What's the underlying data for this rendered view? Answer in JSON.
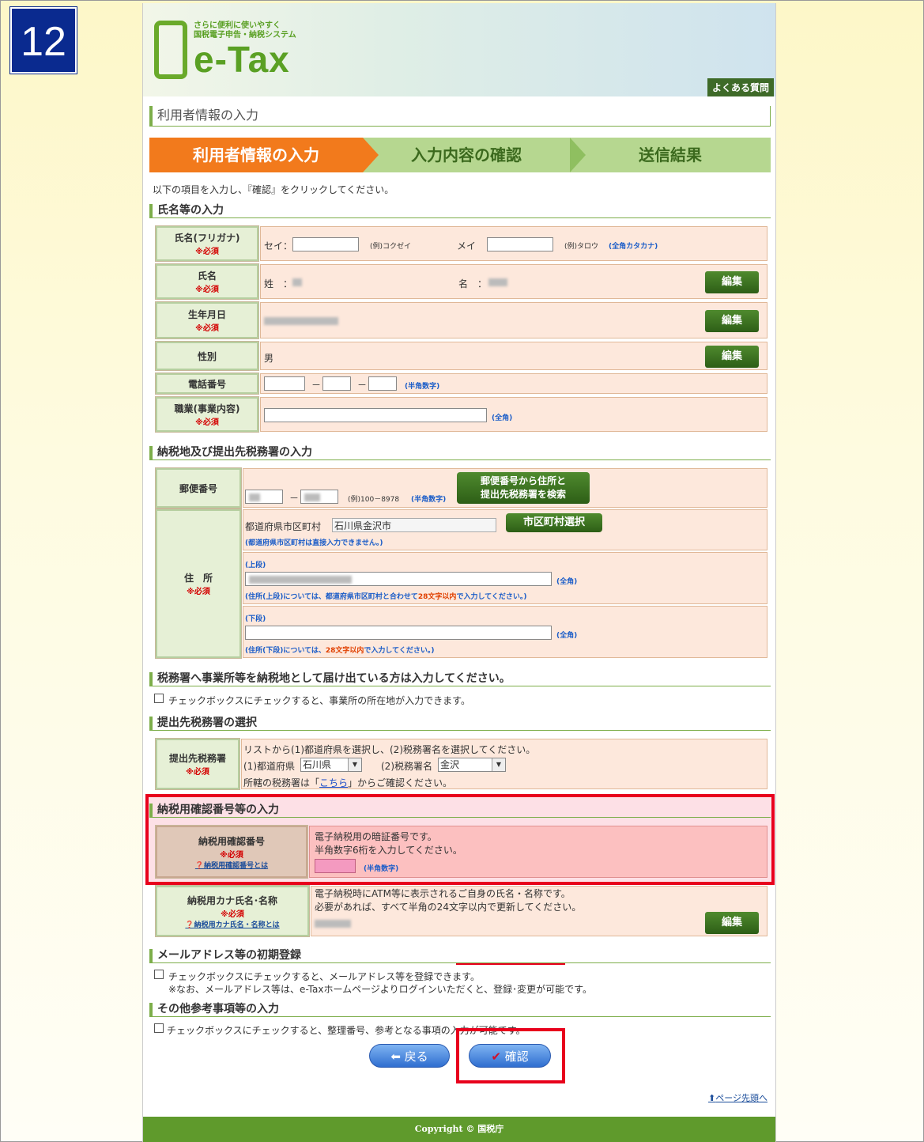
{
  "step_number": "12",
  "header": {
    "tagline1": "さらに便利に使いやすく",
    "tagline2": "国税電子申告・納税システム",
    "logo": "e-Tax",
    "faq": "よくある質問"
  },
  "page_title": "利用者情報の入力",
  "steps": [
    "利用者情報の入力",
    "入力内容の確認",
    "送信結果"
  ],
  "instruction": "以下の項目を入力し、『確認』をクリックしてください。",
  "required": "※必須",
  "section1": {
    "title": "氏名等の入力",
    "furigana": {
      "label": "氏名(フリガナ)",
      "sei": "セイ：",
      "sei_ex": "(例)コクゼイ",
      "mei": "メイ　：",
      "mei_ex": "(例)タロウ",
      "note": "(全角カタカナ)"
    },
    "name": {
      "label": "氏名",
      "sei": "姓　：",
      "mei": "名　：",
      "edit": "編集"
    },
    "birth": {
      "label": "生年月日",
      "edit": "編集"
    },
    "gender": {
      "label": "性別",
      "value": "男",
      "edit": "編集"
    },
    "phone": {
      "label": "電話番号",
      "dash": "－",
      "note": "(半角数字)"
    },
    "job": {
      "label": "職業(事業内容)",
      "note": "(全角)"
    }
  },
  "section2": {
    "title": "納税地及び提出先税務署の入力",
    "postal": {
      "label": "郵便番号",
      "dash": "－",
      "ex": "(例)100－8978",
      "note": "(半角数字)",
      "search1": "郵便番号から住所と",
      "search2": "提出先税務署を検索"
    },
    "address": {
      "label": "住　所",
      "city_label": "都道府県市区町村",
      "city_value": "石川県金沢市",
      "city_btn": "市区町村選択",
      "city_note": "(都道府県市区町村は直接入力できません。)",
      "upper": "(上段)",
      "upper_note_a": "(住所(上段)については、都道府県市区町村と合わせて",
      "upper_note_red": "28文字以内",
      "upper_note_b": "で入力してください。)",
      "lower": "(下段)",
      "lower_note_a": "(住所(下段)については、",
      "lower_note_red": "28文字以内",
      "lower_note_b": "で入力してください。)",
      "fw": "(全角)"
    }
  },
  "section3": {
    "title": "税務署へ事業所等を納税地として届け出ている方は入力してください。",
    "check": "チェックボックスにチェックすると、事業所の所在地が入力できます。"
  },
  "section4": {
    "title": "提出先税務署の選択",
    "label": "提出先税務署",
    "line1": "リストから(1)都道府県を選択し、(2)税務署名を選択してください。",
    "pref_label": "(1)都道府県",
    "pref_value": "石川県",
    "office_label": "(2)税務署名",
    "office_value": "金沢",
    "line3a": "所轄の税務署は「",
    "link": "こちら",
    "line3b": "」からご確認ください。"
  },
  "section5": {
    "title": "納税用確認番号等の入力",
    "pin": {
      "label": "納税用確認番号",
      "help": "納税用確認番号とは",
      "line1": "電子納税用の暗証番号です。",
      "line2": "半角数字6桁を入力してください。",
      "note": "(半角数字)"
    },
    "kana": {
      "label": "納税用カナ氏名･名称",
      "help": "納税用カナ氏名・名称とは",
      "line1": "電子納税時にATM等に表示されるご自身の氏名・名称です。",
      "line2": "必要があれば、すべて半角の24文字以内で更新してください。",
      "edit": "編集"
    }
  },
  "section6": {
    "title": "メールアドレス等の初期登録",
    "check": "チェックボックスにチェックすると、メールアドレス等を登録できます。",
    "note": "※なお、メールアドレス等は、e-Taxホームページよりログインいただくと、登録･変更が可能です。"
  },
  "section7": {
    "title": "その他参考事項等の入力",
    "check": "チェックボックスにチェックすると、整理番号、参考となる事項の入力が可能です。"
  },
  "buttons": {
    "back": "戻る",
    "confirm": "確認"
  },
  "top_link": "ページ先頭へ",
  "footer": "Copyright © 国税庁"
}
